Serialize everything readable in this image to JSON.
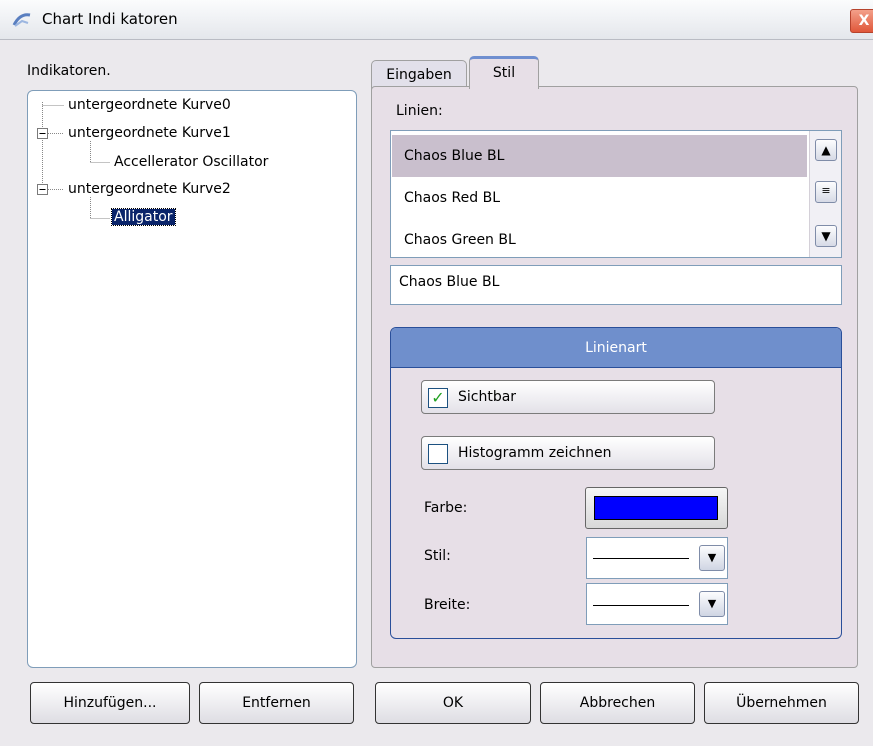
{
  "window": {
    "title": "Chart Indi katoren",
    "close_glyph": "X"
  },
  "left": {
    "label": "Indikatoren.",
    "tree": [
      {
        "label": "untergeordnete Kurve0"
      },
      {
        "label": "untergeordnete Kurve1"
      },
      {
        "label": "Accellerator Oscillator"
      },
      {
        "label": "untergeordnete Kurve2"
      },
      {
        "label": "Alligator",
        "selected": true
      }
    ]
  },
  "tabs": [
    {
      "label": "Eingaben"
    },
    {
      "label": "Stil",
      "active": true
    }
  ],
  "style_tab": {
    "lines_label": "Linien:",
    "lines": [
      "Chaos Blue BL",
      "Chaos Red BL",
      "Chaos Green BL"
    ],
    "selected_line": "Chaos Blue BL",
    "name_field_value": "Chaos Blue BL",
    "group_title": "Linienart",
    "visible_checkbox": {
      "label": "Sichtbar",
      "checked": true
    },
    "histogram_checkbox": {
      "label": "Histogramm zeichnen",
      "checked": false
    },
    "color_label": "Farbe:",
    "color_value": "#0000ff",
    "style_label": "Stil:",
    "width_label": "Breite:"
  },
  "buttons": {
    "add": "Hinzufügen...",
    "remove": "Entfernen",
    "ok": "OK",
    "cancel": "Abbrechen",
    "apply": "Übernehmen"
  },
  "icons": {
    "app": "chart-icon",
    "scroll_up": "chevron-up-icon",
    "scroll_down": "chevron-down-icon",
    "dropdown": "chevron-down-icon",
    "check": "check-icon"
  },
  "colors": {
    "group_header": "#6f8fcc",
    "selection": "#0a246a",
    "swatch": "#0000ff"
  }
}
